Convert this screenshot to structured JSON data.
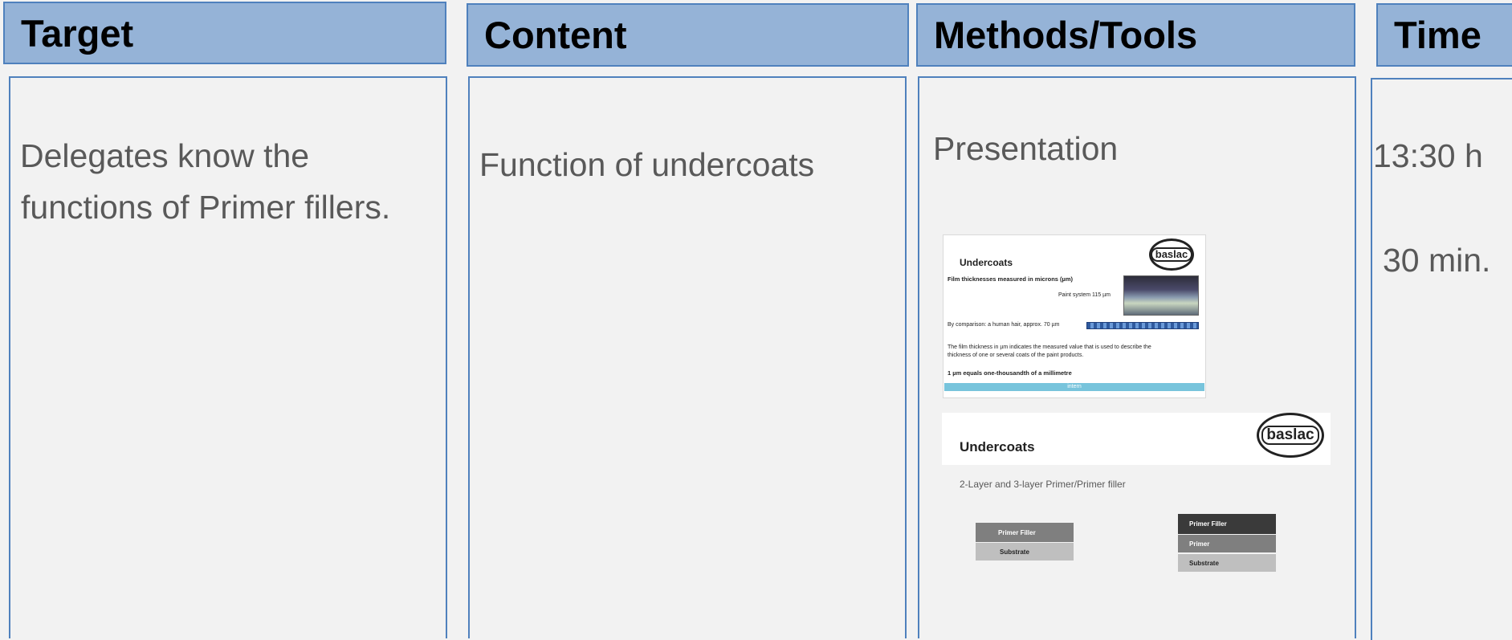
{
  "headers": {
    "target": "Target",
    "content": "Content",
    "methods": "Methods/Tools",
    "time": "Time"
  },
  "target": {
    "line1": "Delegates know the",
    "line2": "functions of Primer fillers."
  },
  "content": {
    "text": "Function of undercoats"
  },
  "methods": {
    "text": "Presentation",
    "slide1": {
      "title": "Undercoats",
      "logo": "baslac",
      "line1": "Film thicknesses measured in microns (µm)",
      "line2": "Paint system 115 µm",
      "line3": "By comparison: a human hair, approx. 70 µm",
      "line4": "The film thickness in µm indicates the measured value that is used to describe the",
      "line5": "thickness of one or several coats of the paint products.",
      "line6": "1 µm equals one-thousandth of a millimetre",
      "footer": "intern"
    },
    "slide2": {
      "title": "Undercoats",
      "logo": "baslac",
      "subtitle": "2-Layer and 3-layer Primer/Primer filler",
      "left_stack": [
        "Primer Filler",
        "Substrate"
      ],
      "right_stack": [
        "Primer Filler",
        "Primer",
        "Substrate"
      ]
    }
  },
  "time": {
    "start": "13:30 h",
    "duration": "30 min."
  },
  "colors": {
    "header_fill": "#95b3d7",
    "border": "#4f81bd",
    "body_text": "#595959",
    "background": "#f2f2f2"
  }
}
